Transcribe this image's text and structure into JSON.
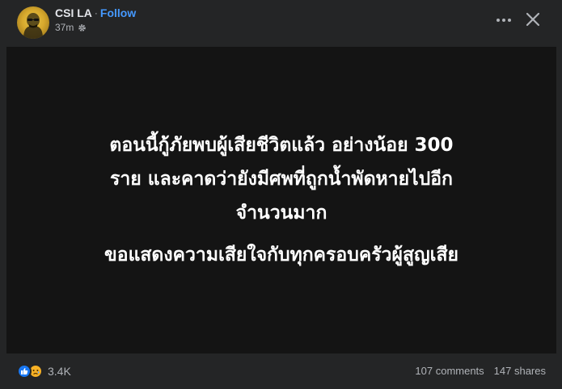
{
  "header": {
    "page_name": "CSI LA",
    "separator": "·",
    "follow_label": "Follow",
    "time": "37m",
    "privacy_icon": "gear-icon"
  },
  "content": {
    "lines": [
      "ตอนนี้กู้ภัยพบผู้เสียชีวิตแล้ว อย่างน้อย 300",
      "ราย และคาดว่ายังมีศพที่ถูกน้ำพัดหายไปอีก",
      "จำนวนมาก",
      "ขอแสดงความเสียใจกับทุกครอบครัวผู้สูญเสีย"
    ],
    "background": "#141414",
    "text_color": "#ffffff"
  },
  "footer": {
    "reaction_icons": [
      "like-icon",
      "sad-icon"
    ],
    "reaction_count": "3.4K",
    "comments": "107 comments",
    "shares": "147 shares"
  },
  "colors": {
    "surface": "#242526",
    "accent": "#4599ff",
    "secondary_text": "#b0b3b8"
  }
}
